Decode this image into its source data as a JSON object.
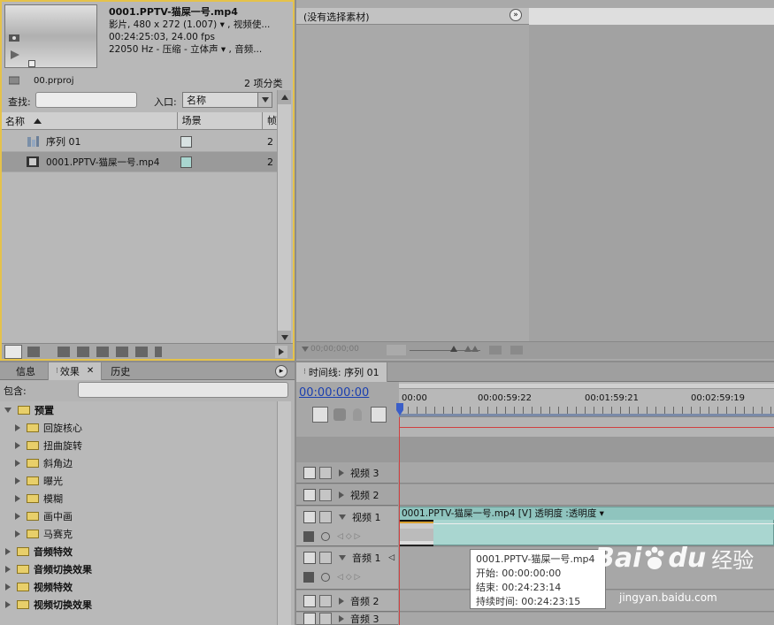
{
  "project": {
    "clip_name": "0001.PPTV-猫屎一号.mp4",
    "meta_line1": "影片, 480 x 272 (1.007)  ▾ , 视频使...",
    "meta_line2": "00:24:25:03, 24.00 fps",
    "meta_line3": "22050 Hz - 压缩 - 立体声  ▾ , 音频...",
    "file_name": "00.prproj",
    "item_count": "2 项分类",
    "search_label": "查找:",
    "entry_label": "入口:",
    "entry_value": "名称",
    "col_name": "名称",
    "col_scene": "场景",
    "col_frame": "帧",
    "items": [
      {
        "label": "序列 01",
        "frame": "2"
      },
      {
        "label": "0001.PPTV-猫屎一号.mp4",
        "frame": "2"
      }
    ]
  },
  "source": {
    "title": "(没有选择素材)",
    "timecode": "00;00;00;00"
  },
  "effects": {
    "tabs": [
      "信息",
      "效果",
      "历史"
    ],
    "contains_label": "包含:",
    "preset_label": "预置",
    "presets": [
      "回旋核心",
      "扭曲旋转",
      "斜角边",
      "曝光",
      "模糊",
      "画中画",
      "马赛克"
    ],
    "folders": [
      "音频特效",
      "音频切换效果",
      "视频特效",
      "视频切换效果"
    ]
  },
  "timeline": {
    "tab": "时间线: 序列 01",
    "timecode": "00:00:00:00",
    "ruler": [
      "00:00",
      "00:00:59:22",
      "00:01:59:21",
      "00:02:59:19"
    ],
    "tracks": {
      "v3": "视频 3",
      "v2": "视频 2",
      "v1": "视频 1",
      "a1": "音频 1",
      "a2": "音频 2",
      "a3": "音频 3"
    },
    "clip_label": "0001.PPTV-猫屎一号.mp4 [V]  透明度 :透明度 ▾"
  },
  "tooltip": {
    "name": "0001.PPTV-猫屎一号.mp4",
    "start": "开始: 00:00:00:00",
    "end": "结束: 00:24:23:14",
    "duration": "持续时间: 00:24:23:15"
  },
  "watermark": {
    "brand": "Bai",
    "brand2": "du",
    "jingyan": "经验",
    "url": "jingyan.baidu.com"
  },
  "colors": {
    "accent_border": "#e5c24a",
    "timecode_blue": "#1a3fb0",
    "clip_fill": "#a9d6d0",
    "playhead": "#d04040"
  }
}
